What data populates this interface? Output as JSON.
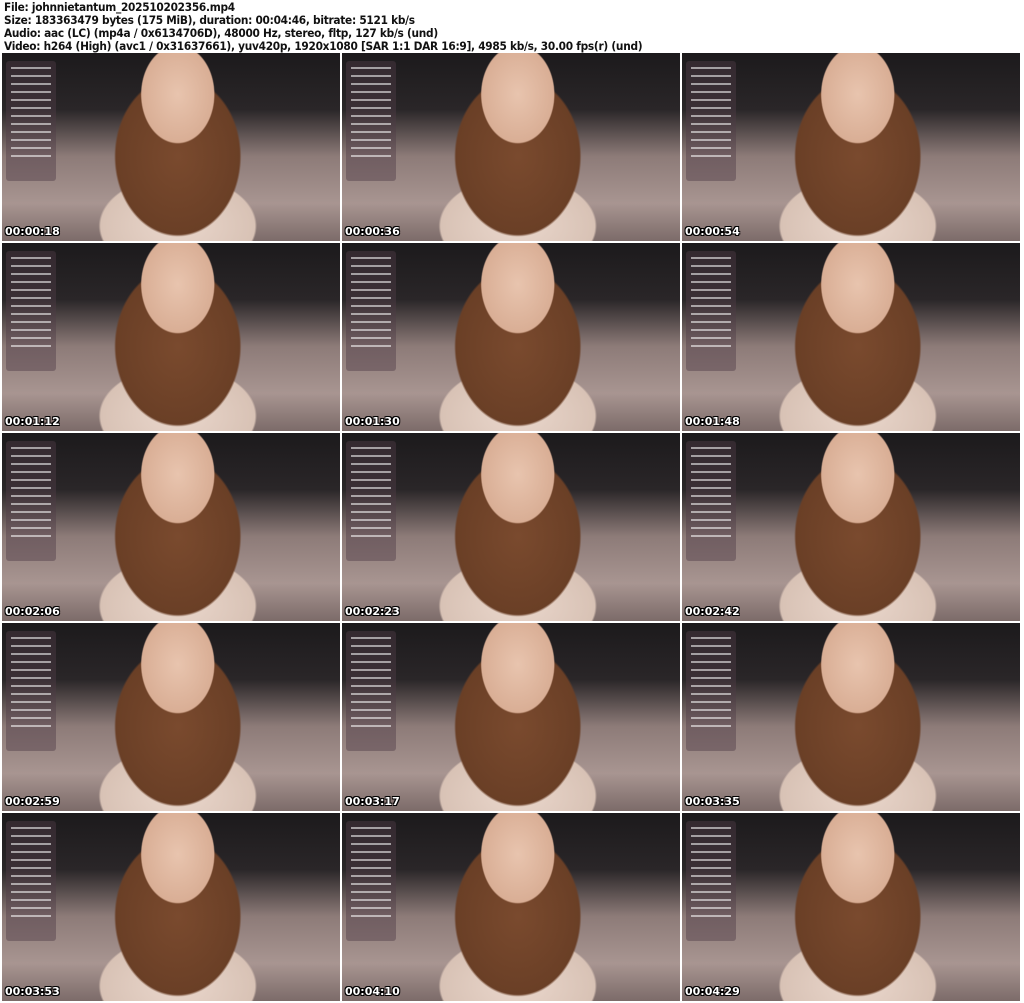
{
  "header": {
    "file": "File: johnnietantum_202510202356.mp4",
    "size": "Size: 183363479 bytes (175 MiB), duration: 00:04:46, bitrate: 5121 kb/s",
    "audio": "Audio: aac (LC) (mp4a / 0x6134706D), 48000 Hz, stereo, fltp, 127 kb/s (und)",
    "video": "Video: h264 (High) (avc1 / 0x31637661), yuv420p, 1920x1080 [SAR 1:1 DAR 16:9], 4985 kb/s, 30.00 fps(r) (und)"
  },
  "thumbnails": [
    {
      "timestamp": "00:00:18"
    },
    {
      "timestamp": "00:00:36"
    },
    {
      "timestamp": "00:00:54"
    },
    {
      "timestamp": "00:01:12"
    },
    {
      "timestamp": "00:01:30"
    },
    {
      "timestamp": "00:01:48"
    },
    {
      "timestamp": "00:02:06"
    },
    {
      "timestamp": "00:02:23"
    },
    {
      "timestamp": "00:02:42"
    },
    {
      "timestamp": "00:02:59"
    },
    {
      "timestamp": "00:03:17"
    },
    {
      "timestamp": "00:03:35"
    },
    {
      "timestamp": "00:03:53"
    },
    {
      "timestamp": "00:04:10"
    },
    {
      "timestamp": "00:04:29"
    }
  ]
}
